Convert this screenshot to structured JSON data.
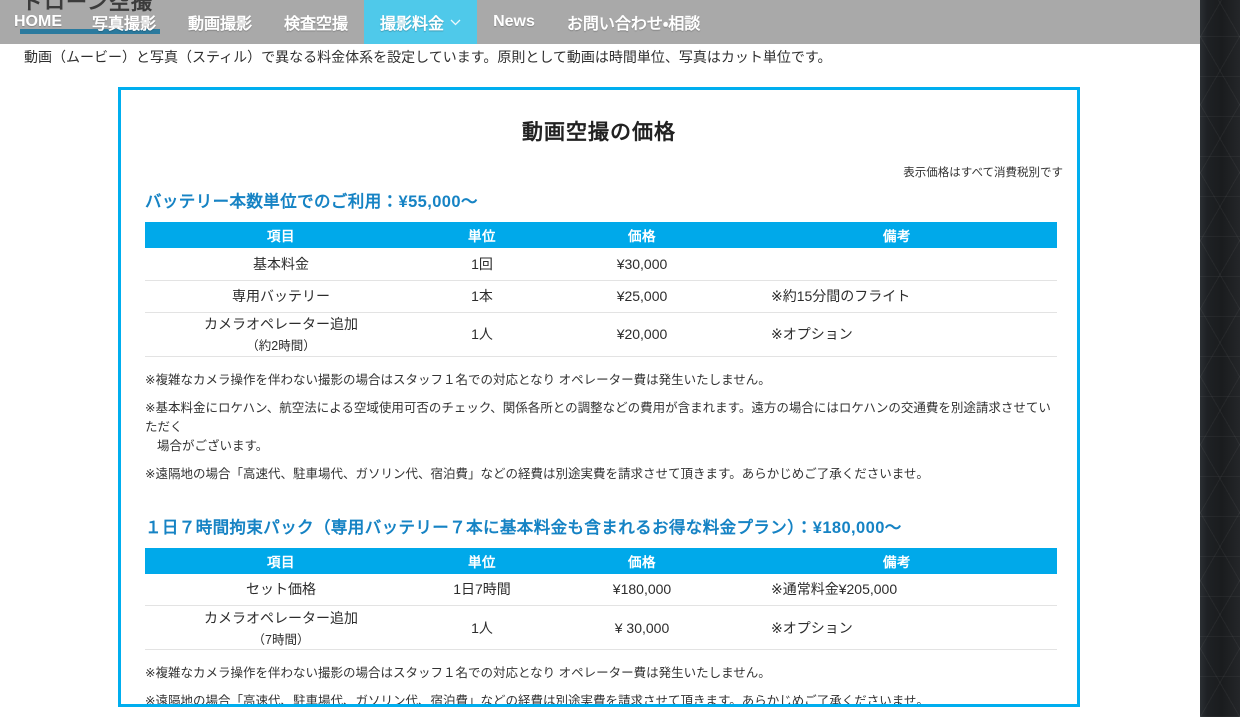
{
  "site": {
    "logo_text": "ドローン空撮"
  },
  "nav": {
    "items": [
      {
        "label": "HOME",
        "active": false,
        "has_chevron": false
      },
      {
        "label": "写真撮影",
        "active": false,
        "has_chevron": false
      },
      {
        "label": "動画撮影",
        "active": false,
        "has_chevron": false
      },
      {
        "label": "検査空撮",
        "active": false,
        "has_chevron": false
      },
      {
        "label": "撮影料金",
        "active": true,
        "has_chevron": true
      },
      {
        "label": "News",
        "active": false,
        "has_chevron": false
      },
      {
        "label": "お問い合わせ・相談",
        "active": false,
        "has_chevron": false
      }
    ],
    "active_color": "#4fc9ea",
    "bar_color": "#a9a9a9",
    "underline_color": "#2b7a9e"
  },
  "intro": {
    "text": "動画（ムービー）と写真（スティル）で異なる料金体系を設定しています。原則として動画は時間単位、写真はカット単位です。"
  },
  "panel": {
    "border_color": "#00aeef",
    "title": "動画空撮の価格",
    "tax_note": "表示価格はすべて消費税別です"
  },
  "section1": {
    "heading": "バッテリー本数単位でのご利用：¥55,000〜",
    "table": {
      "header_color": "#00a9ea",
      "columns": [
        "項目",
        "単位",
        "価格",
        "備考"
      ],
      "rows": [
        {
          "item": "基本料金",
          "item_sub": "",
          "unit": "1回",
          "price": "¥30,000",
          "note": ""
        },
        {
          "item": "専用バッテリー",
          "item_sub": "",
          "unit": "1本",
          "price": "¥25,000",
          "note": "※約15分間のフライト"
        },
        {
          "item": "カメラオペレーター追加",
          "item_sub": "（約2時間）",
          "unit": "1人",
          "price": "¥20,000",
          "note": "※オプション"
        }
      ]
    },
    "notes": [
      {
        "main": "※複雑なカメラ操作を伴わない撮影の場合はスタッフ１名での対応となり オペレーター費は発生いたしません。",
        "cont": ""
      },
      {
        "main": "※基本料金にロケハン、航空法による空域使用可否のチェック、関係各所との調整などの費用が含まれます。遠方の場合にはロケハンの交通費を別途請求させていただく",
        "cont": "場合がございます。"
      },
      {
        "main": "※遠隔地の場合「高速代、駐車場代、ガソリン代、宿泊費」などの経費は別途実費を請求させて頂きます。あらかじめご了承くださいませ。",
        "cont": ""
      }
    ]
  },
  "section2": {
    "heading": "１日７時間拘束パック（専用バッテリー７本に基本料金も含まれるお得な料金プラン）：¥180,000〜",
    "table": {
      "header_color": "#00a9ea",
      "columns": [
        "項目",
        "単位",
        "価格",
        "備考"
      ],
      "rows": [
        {
          "item": "セット価格",
          "item_sub": "",
          "unit": "1日7時間",
          "price": "¥180,000",
          "note": "※通常料金¥205,000"
        },
        {
          "item": "カメラオペレーター追加",
          "item_sub": "（7時間）",
          "unit": "1人",
          "price": "¥ 30,000",
          "note": "※オプション"
        }
      ]
    },
    "notes": [
      {
        "main": "※複雑なカメラ操作を伴わない撮影の場合はスタッフ１名での対応となり オペレーター費は発生いたしません。",
        "cont": ""
      },
      {
        "main": "※遠隔地の場合「高速代、駐車場代、ガソリン代、宿泊費」などの経費は別途実費を請求させて頂きます。あらかじめご了承くださいませ。",
        "cont": ""
      }
    ]
  }
}
